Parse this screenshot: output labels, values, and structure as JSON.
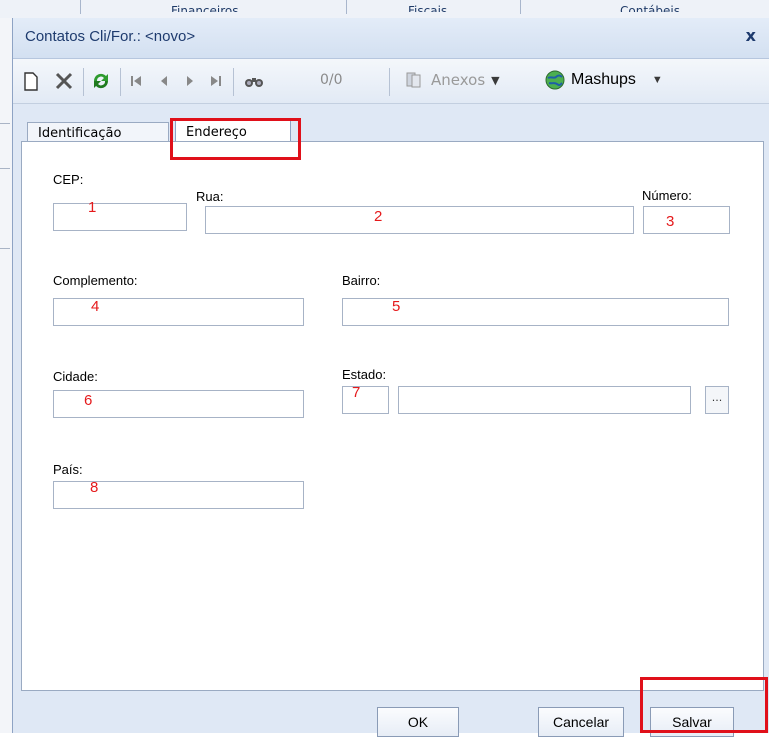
{
  "background": {
    "tabs": [
      "Financeiros",
      "Fiscais",
      "Contábeis"
    ]
  },
  "dialog": {
    "title": "Contatos Cli/For.: <novo>",
    "close_glyph": "x"
  },
  "toolbar": {
    "icons": [
      "new-document-icon",
      "delete-icon",
      "refresh-icon",
      "first-record-icon",
      "previous-record-icon",
      "next-record-icon",
      "last-record-icon",
      "find-icon",
      "attachment-icon",
      "mashups-globe-icon"
    ],
    "counter": "0/0",
    "anexos_label": "Anexos",
    "mashups_label": "Mashups"
  },
  "tabs": [
    {
      "label": "Identificação",
      "active": false
    },
    {
      "label": "Endereço",
      "active": true
    }
  ],
  "form": {
    "cep": {
      "label": "CEP:",
      "marker": "1"
    },
    "rua": {
      "label": "Rua:",
      "marker": "2"
    },
    "numero": {
      "label": "Número:",
      "marker": "3"
    },
    "complemento": {
      "label": "Complemento:",
      "marker": "4"
    },
    "bairro": {
      "label": "Bairro:",
      "marker": "5"
    },
    "cidade": {
      "label": "Cidade:",
      "marker": "6"
    },
    "estado": {
      "label": "Estado:",
      "marker": "7",
      "lookup_label": "..."
    },
    "pais": {
      "label": "País:",
      "marker": "8"
    }
  },
  "buttons": {
    "ok": "OK",
    "cancelar": "Cancelar",
    "salvar": "Salvar"
  },
  "colors": {
    "annotation_red": "#e0101a",
    "window_blue": "#dfe8f5"
  }
}
